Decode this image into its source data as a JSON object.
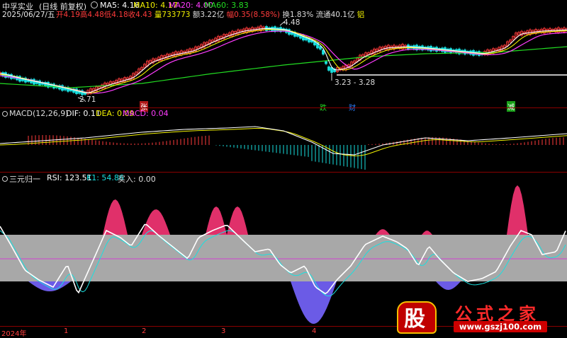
{
  "header": {
    "stock_name": "中孚实业",
    "adjust_mode": "(日线 前复权)",
    "date_line": "2025/06/27/五",
    "open_label": "开",
    "open_value": "4.19",
    "high_label": "高",
    "high_value": "4.48",
    "low_label": "低",
    "low_value": "4.18",
    "close_label": "收",
    "close_value": "4.43",
    "volume_label": "量",
    "volume_value": "733773",
    "amount_label": "额",
    "amount_value": "3.22亿",
    "change_label": "幅",
    "change_value": "0.35(8.58%)",
    "turnover_label": "换",
    "turnover_value": "1.83%",
    "float_label": "流通",
    "float_value": "40.1亿",
    "sector": "铝"
  },
  "ma_legend": {
    "ma5": "MA5: 4.16",
    "ma10": "MA10: 4.17",
    "ma20": "MA20: 4.00",
    "ma60": "MA60: 3.83"
  },
  "price_annotations": {
    "high_mark": "4.48",
    "low_left": "2.71",
    "range_mid": "3.23 - 3.28"
  },
  "event_tags": {
    "tag1": "张",
    "tag2": "跌",
    "tag3": "财",
    "tag4": "减"
  },
  "macd_legend": {
    "title": "MACD(12,26,9)",
    "dif": "DIF: 0.11",
    "dea": "DEA: 0.09",
    "macd": "MACD: 0.04"
  },
  "rsi_legend": {
    "title": "三元归一",
    "rsi": "RSI: 123.51",
    "k1": "K1: 54.86",
    "buy": "买入: 0.00"
  },
  "x_axis": {
    "label_0": "2024年",
    "label_1": "1",
    "label_2": "2",
    "label_3": "3",
    "label_4": "4"
  },
  "watermark": {
    "brand_char": "股",
    "brand_name": "公式之家",
    "url": "www.gszj100.com"
  },
  "colors": {
    "up": "#ff3b3b",
    "down": "#19e0e0",
    "ma5": "#ffffff",
    "ma10": "#f2f200",
    "ma20": "#ff3cff",
    "ma60": "#22dd22",
    "rsi_pink": "#e0306a",
    "rsi_blue": "#6b5be6",
    "band": "#a8a8a8"
  }
}
